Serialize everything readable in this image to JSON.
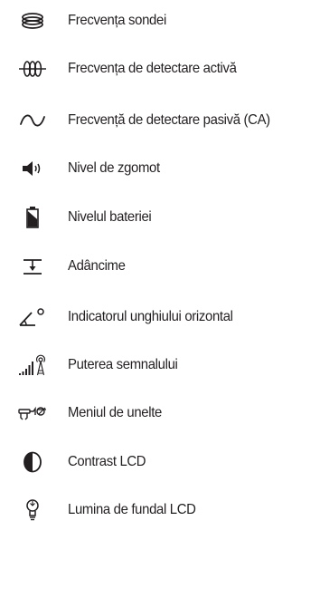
{
  "legend": {
    "items": [
      {
        "icon": "probe-frequency-icon",
        "label": "Frecvența sondei"
      },
      {
        "icon": "active-detection-frequency-icon",
        "label": "Frecvența de detectare activă"
      },
      {
        "icon": "passive-ac-detection-icon",
        "label": "Frecvență de detectare pasivă (CA)"
      },
      {
        "icon": "speaker-volume-icon",
        "label": "Nivel de zgomot"
      },
      {
        "icon": "battery-icon",
        "label": "Nivelul bateriei"
      },
      {
        "icon": "depth-icon",
        "label": "Adâncime"
      },
      {
        "icon": "angle-indicator-icon",
        "label": "Indicatorul unghiului orizontal"
      },
      {
        "icon": "signal-strength-icon",
        "label": "Puterea semnalului"
      },
      {
        "icon": "tools-menu-icon",
        "label": "Meniul de unelte"
      },
      {
        "icon": "contrast-icon",
        "label": "Contrast LCD"
      },
      {
        "icon": "backlight-icon",
        "label": "Lumina de fundal LCD"
      }
    ]
  }
}
